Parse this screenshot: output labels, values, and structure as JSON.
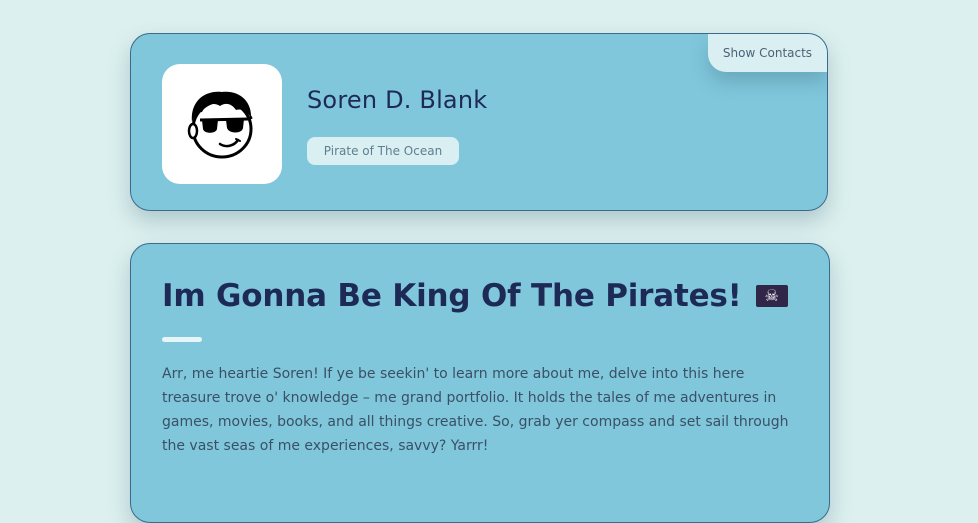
{
  "profile": {
    "name": "Soren D. Blank",
    "title": "Pirate of The Ocean",
    "contacts_label": "Show Contacts",
    "avatar_icon": "cartoon-avatar-sunglasses-icon"
  },
  "about": {
    "heading": "Im Gonna Be King Of The Pirates!",
    "flag_icon": "pirate-flag-icon",
    "text": "Arr, me heartie Soren! If ye be seekin' to learn more about me, delve into this here treasure trove o' knowledge – me grand portfolio. It holds the tales of me adventures in games, movies, books, and all things creative. So, grab yer compass and set sail through the vast seas of me experiences, savvy? Yarrr!"
  },
  "colors": {
    "page_bg": "#dcf0ef",
    "card_bg": "#80c7dc",
    "card_border": "#3b6a8c",
    "heading": "#1d2a56",
    "pill_bg": "#d9eff1"
  }
}
